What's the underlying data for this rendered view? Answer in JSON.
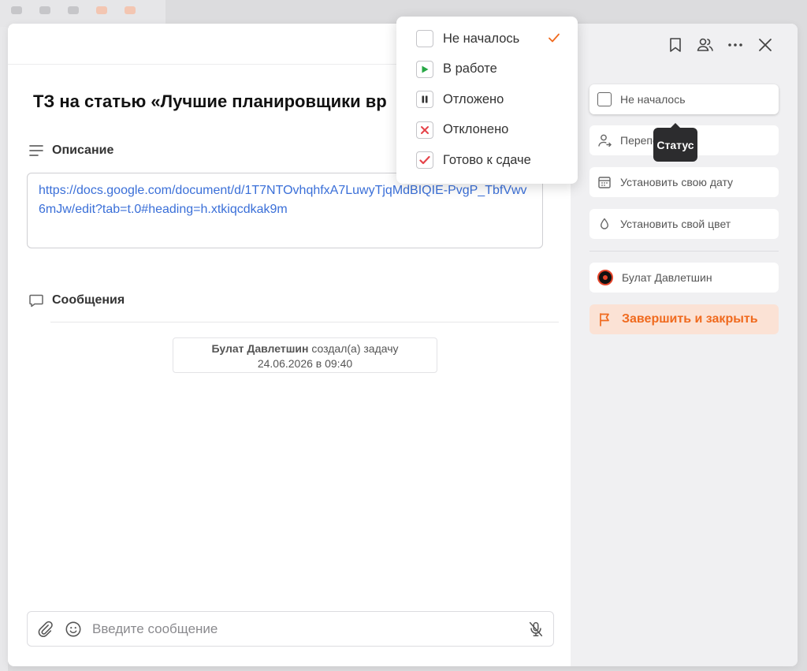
{
  "task": {
    "title": "ТЗ на статью «Лучшие планировщики вр"
  },
  "description": {
    "heading": "Описание",
    "link": "https://docs.google.com/document/d/1T7NTOvhqhfxA7LuwyTjqMdBIQIE-PvgP_TbfVwv6mJw/edit?tab=t.0#heading=h.xtkiqcdkak9m"
  },
  "messages": {
    "heading": "Сообщения",
    "event": {
      "author": "Булат Давлетшин",
      "action": " создал(а) задачу",
      "datetime": "24.06.2026 в 09:40"
    }
  },
  "composer": {
    "placeholder": "Введите сообщение"
  },
  "status_menu": {
    "items": [
      {
        "label": "Не началось",
        "icon": "empty-checkbox",
        "selected": true
      },
      {
        "label": "В работе",
        "icon": "play-icon"
      },
      {
        "label": "Отложено",
        "icon": "pause-icon"
      },
      {
        "label": "Отклонено",
        "icon": "cross-icon"
      },
      {
        "label": "Готово к сдаче",
        "icon": "check-icon"
      }
    ]
  },
  "sidebar": {
    "status_label": "Не началось",
    "reassign_label": "Перепо",
    "set_date_label": "Установить свою дату",
    "set_color_label": "Установить свой цвет",
    "assignee_name": "Булат Давлетшин",
    "finish_label": "Завершить и закрыть"
  },
  "tooltip": {
    "text": "Статус"
  },
  "colors": {
    "accent_orange": "#f06a1e",
    "link_blue": "#3a6fd8",
    "green_status": "#27a745",
    "red_status": "#e5434a"
  }
}
